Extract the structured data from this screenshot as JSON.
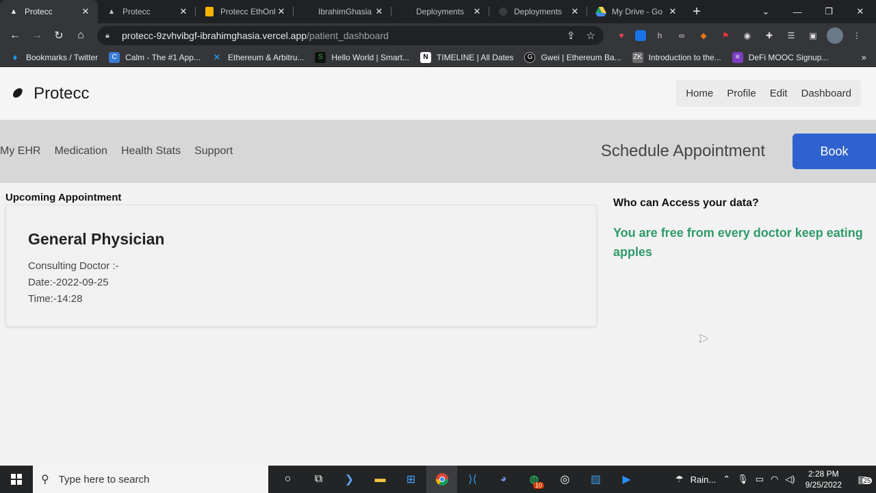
{
  "tabs": [
    {
      "title": "Protecc",
      "icon": "vercel-icon",
      "active": true
    },
    {
      "title": "Protecc",
      "icon": "vercel-icon",
      "active": false
    },
    {
      "title": "Protecc EthOnl",
      "icon": "slides-icon",
      "active": false
    },
    {
      "title": "IbrahimGhasia",
      "icon": "vercel-icon",
      "active": false
    },
    {
      "title": "Deployments",
      "icon": "vercel-icon",
      "active": false
    },
    {
      "title": "Deployments",
      "icon": "github-icon",
      "active": false
    },
    {
      "title": "My Drive - Go",
      "icon": "drive-icon",
      "active": false
    }
  ],
  "omnibox": {
    "host": "protecc-9zvhvibgf-ibrahimghasia.vercel.app",
    "path": "/patient_dashboard"
  },
  "bookmarks": [
    {
      "label": "Bookmarks / Twitter",
      "icon": "twitter-icon",
      "color": "#1d9bf0"
    },
    {
      "label": "Calm - The #1 App...",
      "icon": "calm-icon",
      "color": "#3a7bd5"
    },
    {
      "label": "Ethereum & Arbitru...",
      "icon": "arbitrum-icon",
      "color": "#28a0f0"
    },
    {
      "label": "Hello World | Smart...",
      "icon": "smart-icon",
      "color": "#35a853"
    },
    {
      "label": "TIMELINE | All Dates",
      "icon": "notion-icon",
      "color": "#ffffff"
    },
    {
      "label": "Gwei | Ethereum Ba...",
      "icon": "gwei-icon",
      "color": "#111111"
    },
    {
      "label": "Introduction to the...",
      "icon": "zk-icon",
      "color": "#6b6b6b"
    },
    {
      "label": "DeFi MOOC Signup...",
      "icon": "forms-icon",
      "color": "#7b3fbf"
    }
  ],
  "site": {
    "brand": "Protecc",
    "nav": [
      "Home",
      "Profile",
      "Edit",
      "Dashboard"
    ],
    "subnav": [
      "My EHR",
      "Medication",
      "Health Stats",
      "Support"
    ],
    "schedule_label": "Schedule Appointment",
    "book_label": "Book"
  },
  "appointment": {
    "section_title": "Upcoming Appointment",
    "specialty": "General Physician",
    "doctor": "Consulting Doctor :-",
    "date": "Date:-2022-09-25",
    "time": "Time:-14:28"
  },
  "access": {
    "title": "Who can Access your data?",
    "message": "You are free from every doctor keep eating apples",
    "message_color": "#2f9a6a"
  },
  "taskbar": {
    "search_placeholder": "Type here to search",
    "weather": "Rain...",
    "time": "2:28 PM",
    "date": "9/25/2022",
    "whatsapp_badge": "10",
    "notif_count": "25"
  }
}
